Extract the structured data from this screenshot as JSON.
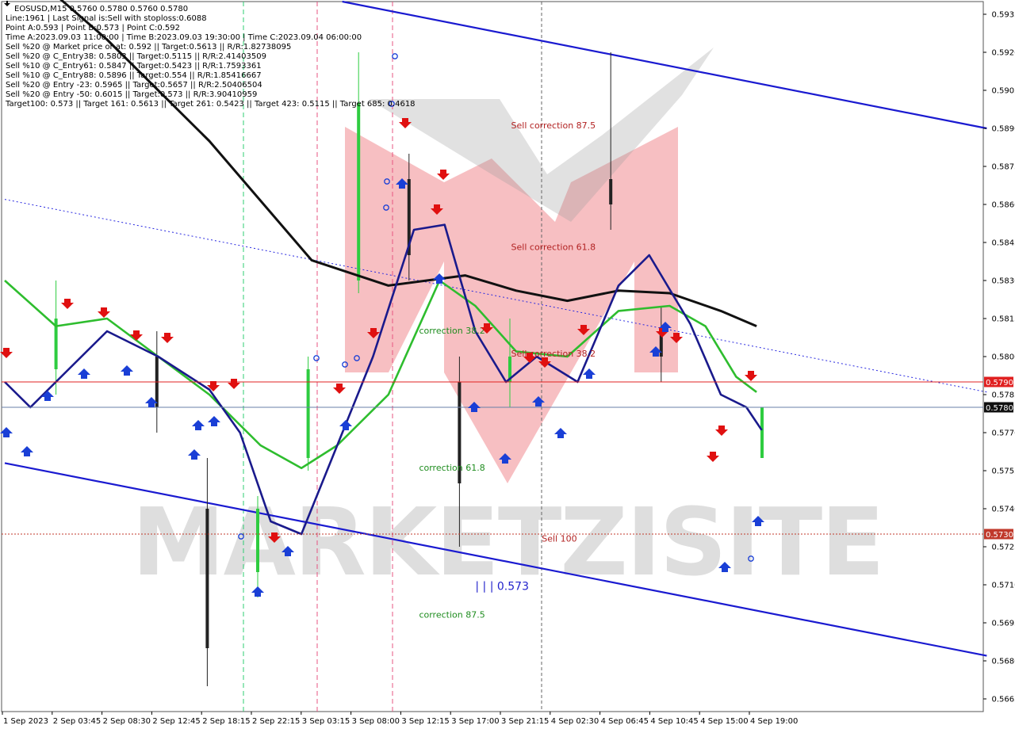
{
  "header": {
    "symbol_line": "EOSUSD,M15  0.5760 0.5780 0.5760 0.5780",
    "lines": [
      "Line:1961 | Last Signal is:Sell with stoploss:0.6088",
      "Point A:0.593 | Point B:0.573 | Point C:0.592",
      "Time A:2023.09.03 11:00:00 | Time B:2023.09.03 19:30:00 | Time C:2023.09.04 06:00:00",
      "Sell %20 @ Market price or at: 0.592 || Target:0.5613 || R/R:1.82738095",
      "Sell %20 @ C_Entry38: 0.5803 || Target:0.5115 || R/R:2.41403509",
      "Sell %10 @ C_Entry61: 0.5847 || Target:0.5423 || R/R:1.7593361",
      "Sell %10 @ C_Entry88: 0.5896 || Target:0.554 || R/R:1.85416667",
      "Sell %20 @ Entry -23: 0.5965 || Target:0.5657 || R/R:2.50406504",
      "Sell %20 @ Entry -50: 0.6015 || Target:0.573 || R/R:3.90410959",
      "Target100: 0.573 || Target 161: 0.5613 || Target 261: 0.5423 || Target 423: 0.5115 || Target 685: 0.4618"
    ]
  },
  "annotations": [
    {
      "text": "Sell correction 87.5",
      "x_index": 99,
      "price": 0.589,
      "color": "red"
    },
    {
      "text": "Sell correction 61.8",
      "x_index": 99,
      "price": 0.5842,
      "color": "red"
    },
    {
      "text": "Sell correction 38.2",
      "x_index": 99,
      "price": 0.58,
      "color": "red"
    },
    {
      "text": "correction 38.2",
      "x_index": 81,
      "price": 0.5809,
      "color": "green"
    },
    {
      "text": "correction 61.8",
      "x_index": 81,
      "price": 0.5755,
      "color": "green"
    },
    {
      "text": "correction 87.5",
      "x_index": 81,
      "price": 0.5697,
      "color": "green"
    },
    {
      "text": "Sell 100",
      "x_index": 105,
      "price": 0.5727,
      "color": "red"
    },
    {
      "text": "| | | 0.573",
      "x_index": 92,
      "price": 0.5708,
      "color": "blue"
    }
  ],
  "price_tags": [
    {
      "label": "0.5790",
      "price": 0.579,
      "color": "#e02020"
    },
    {
      "label": "0.5780",
      "price": 0.578,
      "color": "#101010"
    },
    {
      "label": "0.5730",
      "price": 0.573,
      "color": "#c0392b"
    }
  ],
  "watermark": "MARKETZISITE",
  "chart_data": {
    "type": "candlestick",
    "title": "EOSUSD,M15",
    "y_ticks": [
      "0.5935",
      "0.5920",
      "0.5905",
      "0.5890",
      "0.5875",
      "0.5860",
      "0.5845",
      "0.5830",
      "0.5815",
      "0.5800",
      "0.5785",
      "0.5770",
      "0.5755",
      "0.5740",
      "0.5725",
      "0.5710",
      "0.5695",
      "0.5680",
      "0.5665"
    ],
    "ylim": [
      0.566,
      0.594
    ],
    "x_ticks": [
      "1 Sep 2023",
      "2 Sep 03:45",
      "2 Sep 08:30",
      "2 Sep 12:45",
      "2 Sep 18:15",
      "2 Sep 22:15",
      "3 Sep 03:15",
      "3 Sep 08:00",
      "3 Sep 12:15",
      "3 Sep 17:00",
      "3 Sep 21:15",
      "4 Sep 02:30",
      "4 Sep 06:45",
      "4 Sep 10:45",
      "4 Sep 15:00",
      "4 Sep 19:00"
    ],
    "bars_total": 150,
    "ohlc_sample": [
      {
        "time": "2 Sep 03:45",
        "open": 0.5795,
        "high": 0.583,
        "low": 0.5785,
        "close": 0.5815
      },
      {
        "time": "2 Sep 12:45",
        "open": 0.58,
        "high": 0.581,
        "low": 0.577,
        "close": 0.578
      },
      {
        "time": "2 Sep 18:15",
        "open": 0.574,
        "high": 0.576,
        "low": 0.567,
        "close": 0.5685
      },
      {
        "time": "2 Sep 22:15",
        "open": 0.5715,
        "high": 0.5745,
        "low": 0.5705,
        "close": 0.574
      },
      {
        "time": "3 Sep 03:15",
        "open": 0.576,
        "high": 0.58,
        "low": 0.5755,
        "close": 0.5795
      },
      {
        "time": "3 Sep 08:00",
        "open": 0.583,
        "high": 0.592,
        "low": 0.5825,
        "close": 0.59
      },
      {
        "time": "3 Sep 12:15",
        "open": 0.587,
        "high": 0.588,
        "low": 0.583,
        "close": 0.584
      },
      {
        "time": "3 Sep 17:00",
        "open": 0.579,
        "high": 0.58,
        "low": 0.5725,
        "close": 0.575
      },
      {
        "time": "3 Sep 21:15",
        "open": 0.579,
        "high": 0.5815,
        "low": 0.578,
        "close": 0.58
      },
      {
        "time": "4 Sep 06:45",
        "open": 0.587,
        "high": 0.592,
        "low": 0.585,
        "close": 0.586
      },
      {
        "time": "4 Sep 10:45",
        "open": 0.581,
        "high": 0.582,
        "low": 0.579,
        "close": 0.58
      },
      {
        "time": "4 Sep 19:00",
        "open": 0.576,
        "high": 0.578,
        "low": 0.576,
        "close": 0.578
      }
    ],
    "series": [
      {
        "name": "MA black",
        "color": "#111111",
        "points": [
          [
            0,
            0.596
          ],
          [
            20,
            0.5925
          ],
          [
            40,
            0.5885
          ],
          [
            60,
            0.5838
          ],
          [
            75,
            0.5828
          ],
          [
            90,
            0.5832
          ],
          [
            100,
            0.5826
          ],
          [
            110,
            0.5822
          ],
          [
            120,
            0.5826
          ],
          [
            130,
            0.5825
          ],
          [
            140,
            0.5818
          ],
          [
            147,
            0.5812
          ]
        ]
      },
      {
        "name": "MA green",
        "color": "#2ebd2e",
        "points": [
          [
            0,
            0.583
          ],
          [
            10,
            0.5812
          ],
          [
            20,
            0.5815
          ],
          [
            30,
            0.58
          ],
          [
            40,
            0.5785
          ],
          [
            50,
            0.5765
          ],
          [
            58,
            0.5756
          ],
          [
            65,
            0.5765
          ],
          [
            75,
            0.5785
          ],
          [
            85,
            0.583
          ],
          [
            92,
            0.582
          ],
          [
            100,
            0.5802
          ],
          [
            110,
            0.58
          ],
          [
            120,
            0.5818
          ],
          [
            130,
            0.582
          ],
          [
            137,
            0.5812
          ],
          [
            143,
            0.5792
          ],
          [
            147,
            0.5786
          ]
        ]
      },
      {
        "name": "MA blue",
        "color": "#1a1a8c",
        "points": [
          [
            0,
            0.579
          ],
          [
            5,
            0.578
          ],
          [
            10,
            0.579
          ],
          [
            20,
            0.581
          ],
          [
            30,
            0.58
          ],
          [
            40,
            0.5787
          ],
          [
            46,
            0.577
          ],
          [
            52,
            0.5735
          ],
          [
            58,
            0.573
          ],
          [
            65,
            0.5765
          ],
          [
            72,
            0.58
          ],
          [
            80,
            0.585
          ],
          [
            86,
            0.5852
          ],
          [
            92,
            0.581
          ],
          [
            98,
            0.579
          ],
          [
            104,
            0.58
          ],
          [
            112,
            0.579
          ],
          [
            120,
            0.5828
          ],
          [
            126,
            0.584
          ],
          [
            134,
            0.5813
          ],
          [
            140,
            0.5785
          ],
          [
            145,
            0.578
          ],
          [
            148,
            0.5771
          ]
        ]
      }
    ],
    "channel_lines": [
      {
        "name": "upper",
        "style": "solid",
        "color": "#1a1ad0",
        "from": [
          66,
          0.594
        ],
        "to": [
          192,
          0.589
        ]
      },
      {
        "name": "lower",
        "style": "solid",
        "color": "#1a1ad0",
        "from": [
          0,
          0.5758
        ],
        "to": [
          192,
          0.5682
        ]
      },
      {
        "name": "mid",
        "style": "dotted",
        "color": "#2a2ae0",
        "from": [
          0,
          0.5862
        ],
        "to": [
          192,
          0.5786
        ]
      }
    ]
  }
}
